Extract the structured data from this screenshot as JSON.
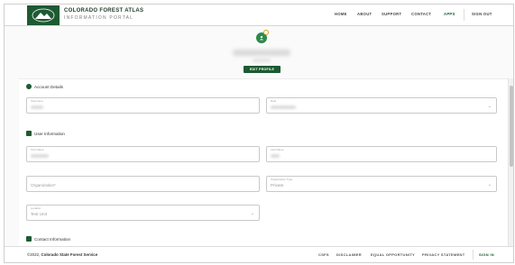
{
  "header": {
    "title": "COLORADO FOREST ATLAS",
    "subtitle": "INFORMATION PORTAL",
    "nav": [
      "HOME",
      "ABOUT",
      "SUPPORT",
      "CONTACT",
      "APPS",
      "SIGN OUT"
    ]
  },
  "profile": {
    "edit_label": "EDIT PROFILE"
  },
  "sections": {
    "account": "Account Details",
    "user": "User Information",
    "contact": "Contact Information"
  },
  "fields": {
    "username_label": "Username",
    "role_label": "Role",
    "first_name_label": "First Name",
    "last_name_label": "Last Name",
    "organization_placeholder": "Organization*",
    "org_type_label": "Organization Type",
    "org_type_value": "Private",
    "location_label": "Location",
    "location_value": "Test Unit"
  },
  "footer": {
    "copyright_prefix": "©2022,",
    "copyright_org": "Colorado State Forest Service",
    "links": [
      "CSFS",
      "DISCLAIMER",
      "EQUAL OPPORTUNITY",
      "PRIVACY STATEMENT",
      "SIGN IN"
    ]
  },
  "colors": {
    "brand_green": "#1d5a32",
    "accent_green": "#2d8a4a"
  }
}
